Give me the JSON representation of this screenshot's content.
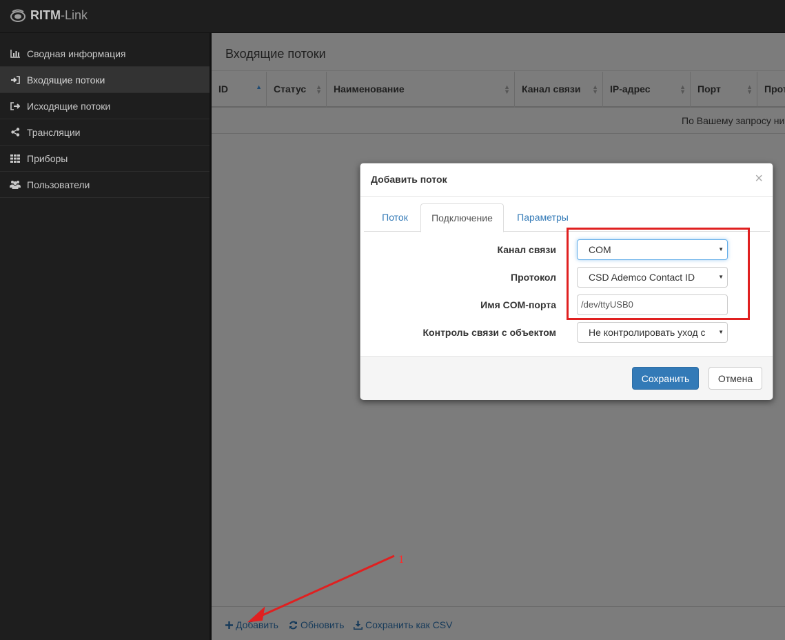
{
  "app": {
    "brand_bold": "RITM",
    "brand_rest": "-Link"
  },
  "sidebar": {
    "items": [
      {
        "label": "Сводная информация",
        "icon": "bar-chart-icon"
      },
      {
        "label": "Входящие потоки",
        "icon": "sign-in-icon",
        "active": true
      },
      {
        "label": "Исходящие потоки",
        "icon": "sign-out-icon"
      },
      {
        "label": "Трансляции",
        "icon": "share-icon"
      },
      {
        "label": "Приборы",
        "icon": "grid-icon"
      },
      {
        "label": "Пользователи",
        "icon": "users-icon"
      }
    ]
  },
  "main": {
    "title": "Входящие потоки",
    "columns": [
      "ID",
      "Статус",
      "Наименование",
      "Канал связи",
      "IP-адрес",
      "Порт",
      "Прот"
    ],
    "empty_text": "По Вашему запросу ни",
    "toolbar": {
      "add_label": "Добавить",
      "refresh_label": "Обновить",
      "csv_label": "Сохранить как CSV"
    }
  },
  "modal": {
    "title": "Добавить поток",
    "close": "×",
    "tabs": [
      "Поток",
      "Подключение",
      "Параметры"
    ],
    "active_tab": "Подключение",
    "fields": {
      "channel": {
        "label": "Канал связи",
        "value": "COM"
      },
      "protocol": {
        "label": "Протокол",
        "value": "CSD Ademco Contact ID"
      },
      "com_port": {
        "label": "Имя COM-порта",
        "value": "/dev/ttyUSB0"
      },
      "control": {
        "label": "Контроль связи с объектом",
        "value": "Не контролировать уход с"
      }
    },
    "buttons": {
      "save": "Сохранить",
      "cancel": "Отмена"
    }
  },
  "annotation": {
    "number": "1",
    "color": "#e02020"
  }
}
